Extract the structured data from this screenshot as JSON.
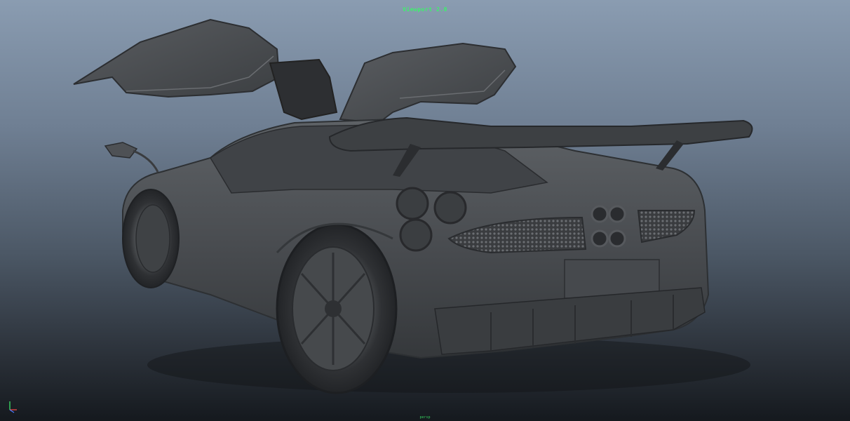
{
  "viewport": {
    "title": "Viewport 2.0",
    "frame_label": "persp"
  },
  "colors": {
    "hud_text": "#3cf26b",
    "bg_top": "#8a9cb1",
    "bg_bottom": "#15191e",
    "model": "#4b4e52"
  },
  "axis_gizmo": {
    "icon": "xyz-axis-icon"
  }
}
